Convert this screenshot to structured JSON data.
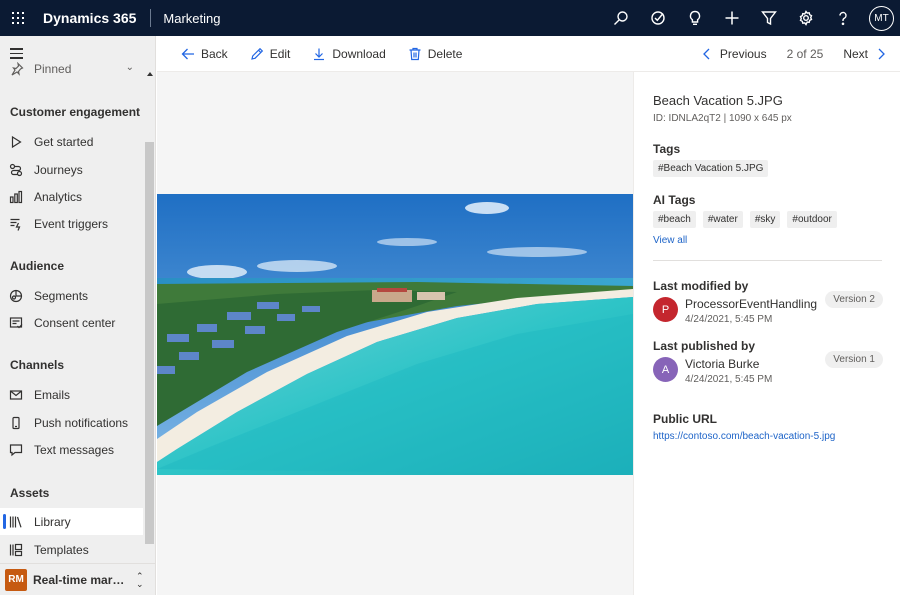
{
  "topbar": {
    "app_name": "Dynamics 365",
    "module": "Marketing",
    "icons": [
      "search-icon",
      "task-check-icon",
      "lightbulb-icon",
      "plus-icon",
      "filter-icon",
      "gear-icon",
      "help-icon"
    ],
    "user_initials": "MT",
    "background": "#0b1a33"
  },
  "sidebar": {
    "pinned_label": "Pinned",
    "sections": [
      {
        "title": "Customer engagement",
        "items": [
          {
            "label": "Get started",
            "icon": "play-icon"
          },
          {
            "label": "Journeys",
            "icon": "journey-icon"
          },
          {
            "label": "Analytics",
            "icon": "analytics-icon"
          },
          {
            "label": "Event triggers",
            "icon": "event-trigger-icon"
          }
        ]
      },
      {
        "title": "Audience",
        "items": [
          {
            "label": "Segments",
            "icon": "segments-icon"
          },
          {
            "label": "Consent center",
            "icon": "consent-icon"
          }
        ]
      },
      {
        "title": "Channels",
        "items": [
          {
            "label": "Emails",
            "icon": "mail-icon"
          },
          {
            "label": "Push notifications",
            "icon": "phone-icon"
          },
          {
            "label": "Text messages",
            "icon": "chat-icon"
          }
        ]
      },
      {
        "title": "Assets",
        "items": [
          {
            "label": "Library",
            "icon": "library-icon",
            "active": true
          },
          {
            "label": "Templates",
            "icon": "templates-icon"
          }
        ]
      }
    ],
    "area": {
      "initials": "RM",
      "label": "Real-time marketi…",
      "badge_color": "#c65a11"
    }
  },
  "commands": {
    "back": "Back",
    "edit": "Edit",
    "download": "Download",
    "delete": "Delete",
    "previous": "Previous",
    "position": "2 of 25",
    "next": "Next"
  },
  "details": {
    "file_name": "Beach Vacation 5.JPG",
    "file_meta": "ID: IDNLA2qT2 | 1090 x 645 px",
    "tags_label": "Tags",
    "tags": [
      "#Beach Vacation 5.JPG"
    ],
    "ai_tags_label": "AI Tags",
    "ai_tags": [
      "#beach",
      "#water",
      "#sky",
      "#outdoor"
    ],
    "view_all": "View all",
    "modified_label": "Last modified by",
    "modified_by": {
      "initial": "P",
      "name": "ProcessorEventHandling",
      "date": "4/24/2021, 5:45 PM",
      "version": "Version 2",
      "color": "#c4262e"
    },
    "published_label": "Last published by",
    "published_by": {
      "initial": "A",
      "name": "Victoria Burke",
      "date": "4/24/2021, 5:45 PM",
      "version": "Version 1",
      "color": "#8764b8"
    },
    "public_url_label": "Public URL",
    "public_url": "https://contoso.com/beach-vacation-5.jpg",
    "accent": "#1e64c8"
  }
}
